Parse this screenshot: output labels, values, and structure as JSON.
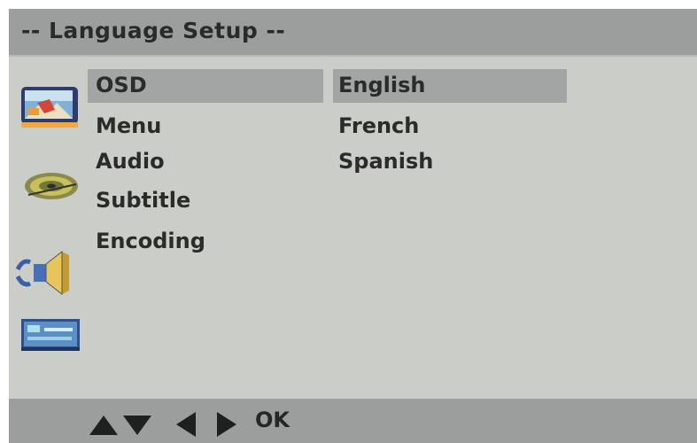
{
  "header": {
    "title": "-- Language Setup --"
  },
  "sidebar": {
    "icons": [
      {
        "name": "tv-screen-icon"
      },
      {
        "name": "disc-icon"
      },
      {
        "name": "speaker-icon"
      },
      {
        "name": "setup-panel-icon"
      }
    ]
  },
  "menu": {
    "items": [
      {
        "label": "OSD",
        "selected": true
      },
      {
        "label": "Menu"
      },
      {
        "label": "Audio"
      },
      {
        "label": "Subtitle"
      },
      {
        "label": "Encoding"
      }
    ]
  },
  "options": {
    "items": [
      {
        "label": "English",
        "selected": true
      },
      {
        "label": "French"
      },
      {
        "label": "Spanish"
      }
    ]
  },
  "footer": {
    "nav_icons": [
      "up-arrow-icon",
      "down-arrow-icon",
      "left-arrow-icon",
      "right-arrow-icon"
    ],
    "ok_label": "OK"
  },
  "colors": {
    "screen_bg": "#cbcdc9",
    "bar_bg": "#9c9d9d",
    "highlight_bg": "#a3a4a4",
    "text": "#2b2b2b"
  }
}
